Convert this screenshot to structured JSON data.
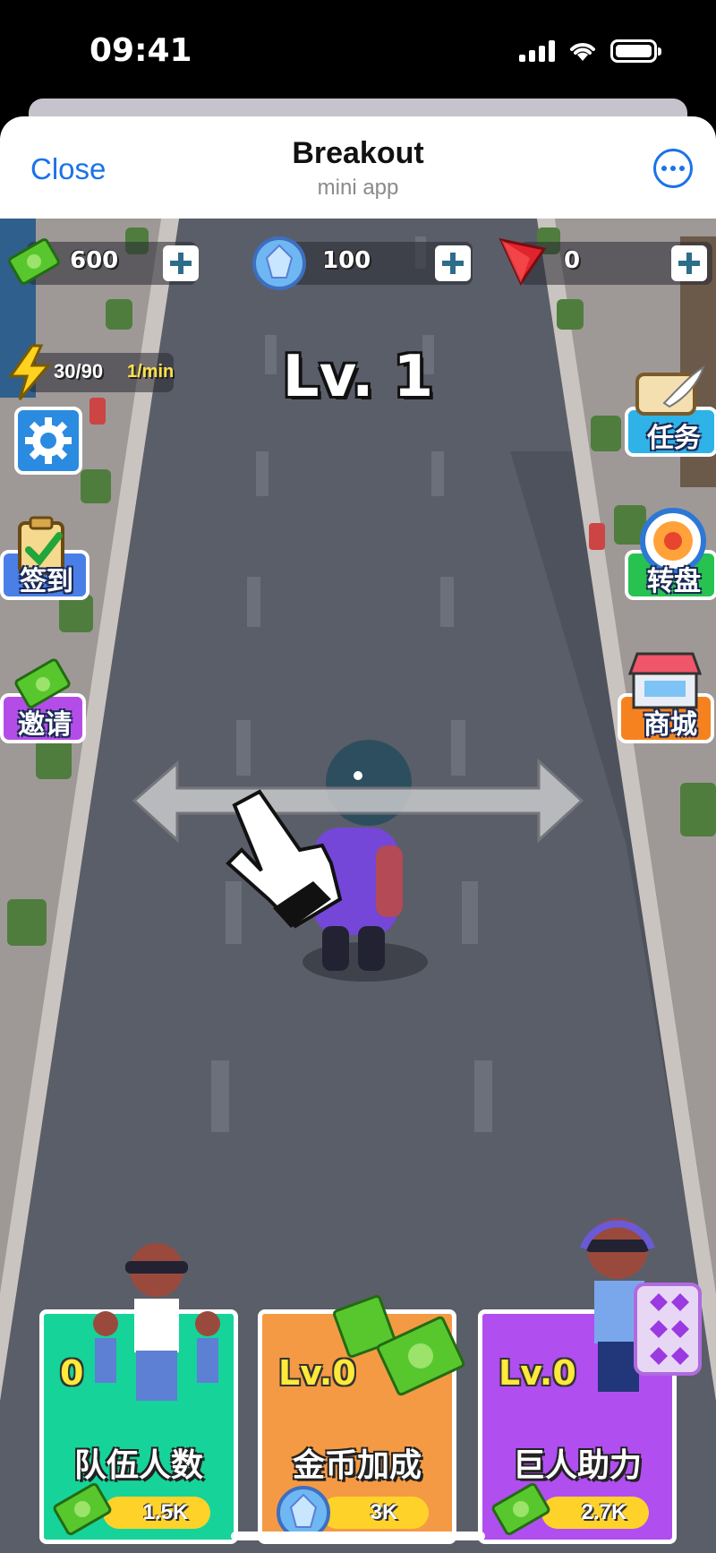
{
  "status_bar": {
    "time": "09:41"
  },
  "header": {
    "close_label": "Close",
    "title": "Breakout",
    "subtitle": "mini app"
  },
  "resources": {
    "cash": "600",
    "gems": "100",
    "tron": "0",
    "energy": "30/90",
    "energy_rate": "1/min"
  },
  "level_label": "Lv. 1",
  "side_buttons": {
    "tasks": "任务",
    "wheel": "转盘",
    "shop": "商城",
    "checkin": "签到",
    "invite": "邀请"
  },
  "cards": [
    {
      "level": "0",
      "name": "队伍人数",
      "cost": "1.5K",
      "currency_icon": "cash-icon",
      "color": "#16d39a"
    },
    {
      "level": "Lv.0",
      "name": "金币加成",
      "cost": "3K",
      "currency_icon": "gem-icon",
      "color": "#f59a44"
    },
    {
      "level": "Lv.0",
      "name": "巨人助力",
      "cost": "2.7K",
      "currency_icon": "cash-icon",
      "color": "#b04ef0"
    }
  ],
  "colors": {
    "accent": "#1a73e8",
    "road": "#585c67",
    "sidewalk": "#a7a2a0"
  }
}
